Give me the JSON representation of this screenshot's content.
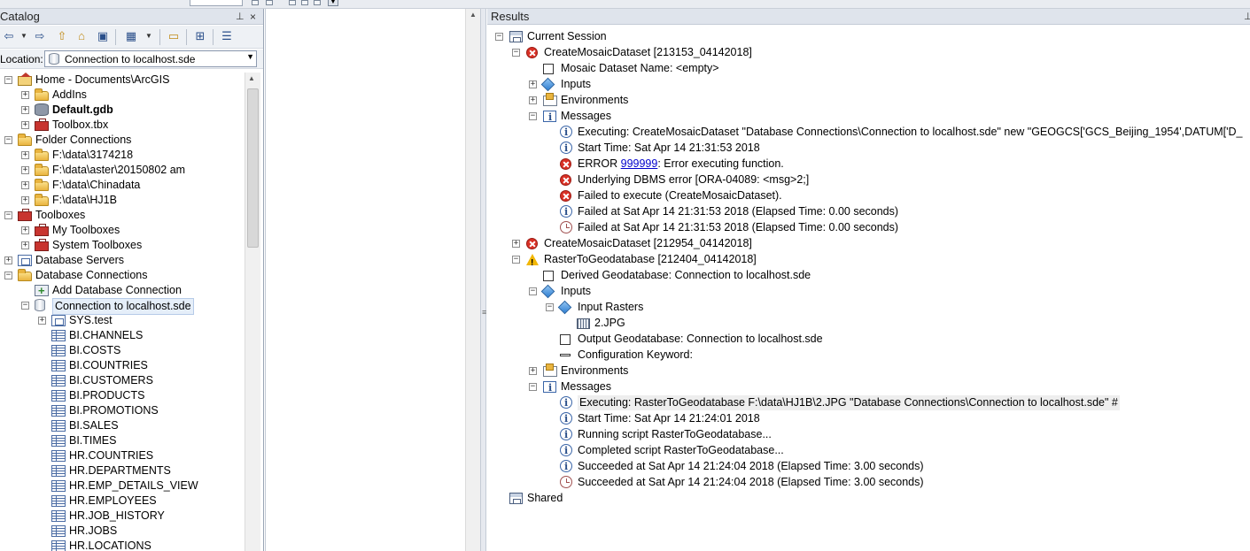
{
  "catalog": {
    "title": "Catalog",
    "pin_glyph": "⬇",
    "location_label": "Location:",
    "location_value": "Connection to localhost.sde",
    "tree": [
      {
        "label": "Home - Documents\\ArcGIS",
        "icon": "home-folder-icon",
        "level": 0,
        "expanded": true
      },
      {
        "label": "AddIns",
        "icon": "folder-icon",
        "level": 1,
        "expanded": false
      },
      {
        "label": "Default.gdb",
        "icon": "geodatabase-icon",
        "level": 1,
        "expanded": false,
        "bold": true
      },
      {
        "label": "Toolbox.tbx",
        "icon": "toolbox-icon",
        "level": 1,
        "expanded": false
      },
      {
        "label": "Folder Connections",
        "icon": "folder-connections-icon",
        "level": 0,
        "expanded": true
      },
      {
        "label": "F:\\data\\3174218",
        "icon": "folder-icon",
        "level": 1,
        "expanded": false
      },
      {
        "label": "F:\\data\\aster\\20150802 am",
        "icon": "folder-icon",
        "level": 1,
        "expanded": false
      },
      {
        "label": "F:\\data\\Chinadata",
        "icon": "folder-icon",
        "level": 1,
        "expanded": false
      },
      {
        "label": "F:\\data\\HJ1B",
        "icon": "folder-icon",
        "level": 1,
        "expanded": false
      },
      {
        "label": "Toolboxes",
        "icon": "toolboxes-icon",
        "level": 0,
        "expanded": true
      },
      {
        "label": "My Toolboxes",
        "icon": "toolbox-icon",
        "level": 1,
        "expanded": false
      },
      {
        "label": "System Toolboxes",
        "icon": "toolbox-icon",
        "level": 1,
        "expanded": false
      },
      {
        "label": "Database Servers",
        "icon": "database-servers-icon",
        "level": 0,
        "expanded": false
      },
      {
        "label": "Database Connections",
        "icon": "database-connections-icon",
        "level": 0,
        "expanded": true
      },
      {
        "label": "Add Database Connection",
        "icon": "add-database-connection-icon",
        "level": 1
      },
      {
        "label": "Connection to localhost.sde",
        "icon": "database-connection-icon",
        "level": 1,
        "expanded": true,
        "selected": true
      },
      {
        "label": "SYS.test",
        "icon": "feature-dataset-icon",
        "level": 2,
        "expanded": false
      },
      {
        "label": "BI.CHANNELS",
        "icon": "table-icon",
        "level": 2
      },
      {
        "label": "BI.COSTS",
        "icon": "table-icon",
        "level": 2
      },
      {
        "label": "BI.COUNTRIES",
        "icon": "table-icon",
        "level": 2
      },
      {
        "label": "BI.CUSTOMERS",
        "icon": "table-icon",
        "level": 2
      },
      {
        "label": "BI.PRODUCTS",
        "icon": "table-icon",
        "level": 2
      },
      {
        "label": "BI.PROMOTIONS",
        "icon": "table-icon",
        "level": 2
      },
      {
        "label": "BI.SALES",
        "icon": "table-icon",
        "level": 2
      },
      {
        "label": "BI.TIMES",
        "icon": "table-icon",
        "level": 2
      },
      {
        "label": "HR.COUNTRIES",
        "icon": "table-icon",
        "level": 2
      },
      {
        "label": "HR.DEPARTMENTS",
        "icon": "table-icon",
        "level": 2
      },
      {
        "label": "HR.EMP_DETAILS_VIEW",
        "icon": "table-icon",
        "level": 2
      },
      {
        "label": "HR.EMPLOYEES",
        "icon": "table-icon",
        "level": 2
      },
      {
        "label": "HR.JOB_HISTORY",
        "icon": "table-icon",
        "level": 2
      },
      {
        "label": "HR.JOBS",
        "icon": "table-icon",
        "level": 2
      },
      {
        "label": "HR.LOCATIONS",
        "icon": "table-icon",
        "level": 2
      }
    ]
  },
  "results": {
    "title": "Results",
    "tree": [
      {
        "label": "Current Session",
        "icon": "session-icon",
        "level": 0,
        "expanded": true
      },
      {
        "label": "CreateMosaicDataset [213153_04142018]",
        "icon": "error-icon",
        "level": 1,
        "expanded": true
      },
      {
        "label": "Mosaic Dataset Name: <empty>",
        "icon": "empty-value-icon",
        "level": 2
      },
      {
        "label": "Inputs",
        "icon": "inputs-icon",
        "level": 2,
        "expanded": false
      },
      {
        "label": "Environments",
        "icon": "environments-icon",
        "level": 2,
        "expanded": false
      },
      {
        "label": "Messages",
        "icon": "messages-icon",
        "level": 2,
        "expanded": true
      },
      {
        "label": "Executing: CreateMosaicDataset \"Database Connections\\Connection to localhost.sde\" new \"GEOGCS['GCS_Beijing_1954',DATUM['D_",
        "icon": "info-icon",
        "level": 3
      },
      {
        "label": "Start Time: Sat Apr 14 21:31:53 2018",
        "icon": "info-icon",
        "level": 3
      },
      {
        "label": "ERROR ",
        "link": "999999",
        "suffix": ": Error executing function.",
        "icon": "error-icon",
        "level": 3
      },
      {
        "label": "Underlying DBMS error [ORA-04089: <msg>2;]",
        "icon": "error-icon",
        "level": 3
      },
      {
        "label": "Failed to execute (CreateMosaicDataset).",
        "icon": "error-icon",
        "level": 3
      },
      {
        "label": "Failed at Sat Apr 14 21:31:53 2018 (Elapsed Time: 0.00 seconds)",
        "icon": "info-icon",
        "level": 3
      },
      {
        "label": "Failed at Sat Apr 14 21:31:53 2018 (Elapsed Time: 0.00 seconds)",
        "icon": "clock-icon",
        "level": 3
      },
      {
        "label": "CreateMosaicDataset [212954_04142018]",
        "icon": "error-icon",
        "level": 1,
        "expanded": false
      },
      {
        "label": "RasterToGeodatabase [212404_04142018]",
        "icon": "warning-icon",
        "level": 1,
        "expanded": true
      },
      {
        "label": "Derived Geodatabase: Connection to localhost.sde",
        "icon": "empty-value-icon",
        "level": 2
      },
      {
        "label": "Inputs",
        "icon": "inputs-icon",
        "level": 2,
        "expanded": true
      },
      {
        "label": "Input Rasters",
        "icon": "inputs-icon",
        "level": 3,
        "expanded": true
      },
      {
        "label": "2.JPG",
        "icon": "raster-icon",
        "level": 4
      },
      {
        "label": "Output Geodatabase: Connection to localhost.sde",
        "icon": "empty-value-icon",
        "level": 3
      },
      {
        "label": "Configuration Keyword:",
        "icon": "string-value-icon",
        "level": 3
      },
      {
        "label": "Environments",
        "icon": "environments-icon",
        "level": 2,
        "expanded": false
      },
      {
        "label": "Messages",
        "icon": "messages-icon",
        "level": 2,
        "expanded": true
      },
      {
        "label": "Executing: RasterToGeodatabase F:\\data\\HJ1B\\2.JPG \"Database Connections\\Connection to localhost.sde\" #",
        "icon": "info-icon",
        "level": 3,
        "highlight": true
      },
      {
        "label": "Start Time: Sat Apr 14 21:24:01 2018",
        "icon": "info-icon",
        "level": 3
      },
      {
        "label": "Running script RasterToGeodatabase...",
        "icon": "info-icon",
        "level": 3
      },
      {
        "label": "Completed script RasterToGeodatabase...",
        "icon": "info-icon",
        "level": 3
      },
      {
        "label": "Succeeded at Sat Apr 14 21:24:04 2018 (Elapsed Time: 3.00 seconds)",
        "icon": "info-icon",
        "level": 3
      },
      {
        "label": "Succeeded at Sat Apr 14 21:24:04 2018 (Elapsed Time: 3.00 seconds)",
        "icon": "clock-icon",
        "level": 3
      },
      {
        "label": "Shared",
        "icon": "shared-icon",
        "level": 0
      }
    ]
  }
}
